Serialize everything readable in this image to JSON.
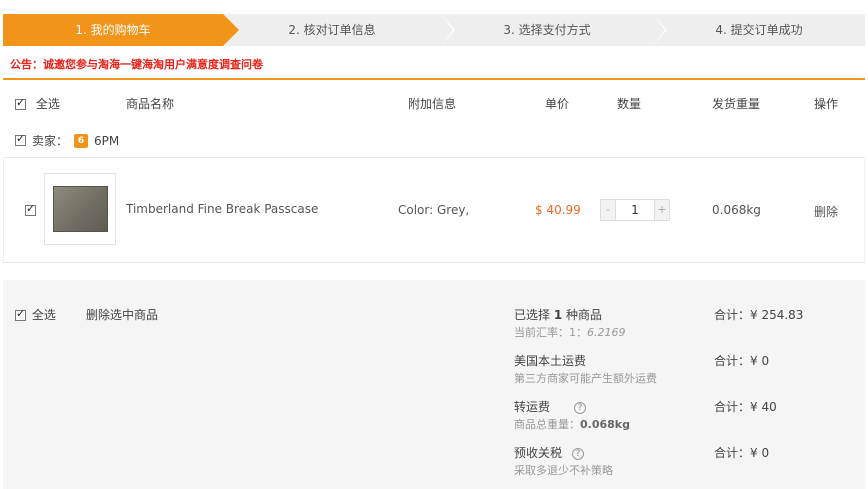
{
  "steps": [
    "1. 我的购物车",
    "2. 核对订单信息",
    "3. 选择支付方式",
    "4. 提交订单成功"
  ],
  "notice": "公告：诚邀您参与淘海一键海淘用户满意度调查问卷",
  "header": {
    "select_all": "全选",
    "name": "商品名称",
    "extra": "附加信息",
    "price": "单价",
    "qty": "数量",
    "weight": "发货重量",
    "action": "操作"
  },
  "seller": {
    "label": "卖家：",
    "logo": "6",
    "name": "6PM"
  },
  "item": {
    "name": "Timberland Fine Break Passcase",
    "extra": "Color: Grey,",
    "price": "$ 40.99",
    "minus": "-",
    "qty": "1",
    "plus": "+",
    "weight": "0.068kg",
    "delete": "删除"
  },
  "summary": {
    "select_all": "全选",
    "delete_selected": "删除选中商品",
    "selected_prefix": "已选择 ",
    "selected_count": "1",
    "selected_suffix": " 种商品",
    "rate_label": "当前汇率：1：",
    "rate_value": "6.2169",
    "total_goods": "合计：¥ 254.83",
    "us_shipping": "美国本土运费",
    "us_shipping_note": "第三方商家可能产生额外运费",
    "total_us_shipping": "合计：¥ 0",
    "transfer_fee": "转运费",
    "weight_label": "商品总重量：",
    "weight_value": "0.068kg",
    "total_transfer": "合计：¥ 40",
    "tax": "预收关税",
    "tax_note": "采取多退少不补策略",
    "total_tax": "合计：¥ 0",
    "help_icon": "?"
  }
}
